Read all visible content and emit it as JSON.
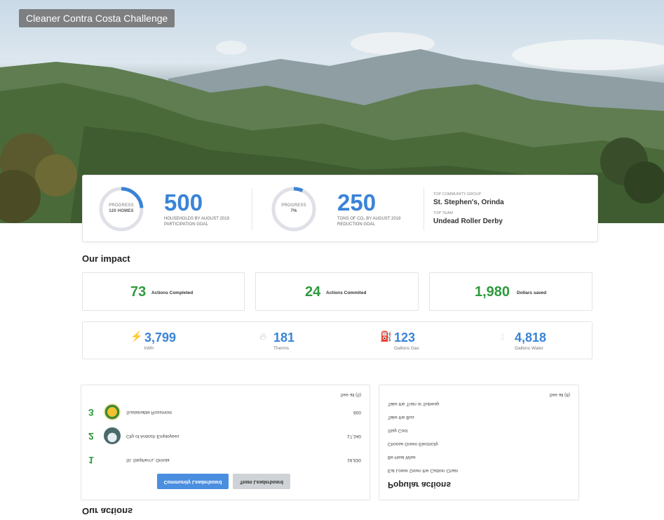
{
  "hero": {
    "title": "Cleaner Contra Costa Challenge"
  },
  "goals": {
    "households": {
      "gauge_label": "PROGRESS",
      "gauge_value": "120 HOMES",
      "progress_fraction": 0.24,
      "number": "500",
      "caption_line1": "HOUSEHOLDS BY AUGUST 2019",
      "caption_line2": "PARTICIPATION GOAL"
    },
    "emissions": {
      "gauge_label": "PROGRESS",
      "gauge_value": "7%",
      "progress_fraction": 0.07,
      "number": "250",
      "caption_line1": "TONS OF CO₂ BY AUGUST 2019",
      "caption_line2": "REDUCTION GOAL"
    },
    "top": {
      "community_label": "TOP COMMUNITY GROUP",
      "community_value": "St. Stephen's, Orinda",
      "team_label": "TOP TEAM",
      "team_value": "Undead Roller Derby"
    }
  },
  "impact": {
    "title": "Our impact",
    "stats": [
      {
        "value": "73",
        "label": "Actions Completed"
      },
      {
        "value": "24",
        "label": "Actions Commited"
      },
      {
        "value": "1,980",
        "label": "Dollars saved"
      }
    ],
    "resources": [
      {
        "icon": "lightning-icon",
        "value": "3,799",
        "unit": "kWh"
      },
      {
        "icon": "flame-icon",
        "value": "181",
        "unit": "Therms"
      },
      {
        "icon": "gas-pump-icon",
        "value": "123",
        "unit": "Gallons Gas"
      },
      {
        "icon": "water-drop-icon",
        "value": "4,818",
        "unit": "Gallons Water"
      }
    ]
  },
  "actions": {
    "title": "Our actions",
    "leaderboard": {
      "see_all": "See all (5)",
      "rows": [
        {
          "rank": "1",
          "name": "St. Stephen's, Orinda",
          "value": "18,830"
        },
        {
          "rank": "2",
          "name": "City of Antioch Employees",
          "value": "17,340"
        },
        {
          "rank": "3",
          "name": "Sustainable Rossmoor",
          "value": "800"
        }
      ],
      "community_button": "Community Leaderboard",
      "team_button": "Team Leaderboard"
    },
    "popular": {
      "title": "Popular actions",
      "see_all": "See all (8)",
      "items": [
        "Eat Lower Down the Carbon Chain",
        "Be Heat Wise",
        "Choose Green Electricity",
        "Stay Cool",
        "Take the Bus",
        "Take the Train or Subway"
      ]
    }
  },
  "colors": {
    "accent_blue": "#3a84d6",
    "accent_green": "#2e9a3e"
  }
}
